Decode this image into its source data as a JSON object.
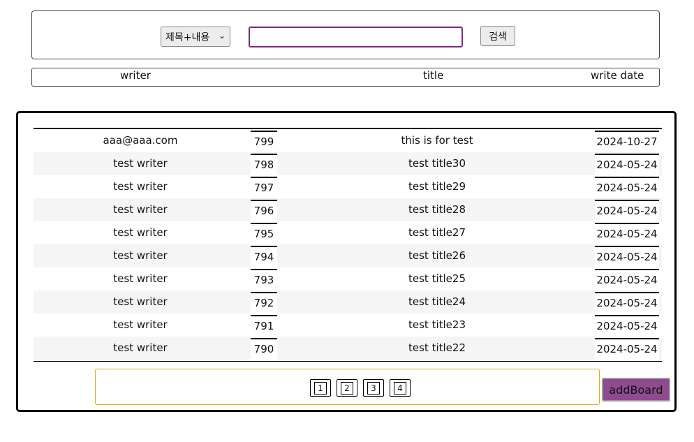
{
  "search": {
    "select_value": "제목+내용",
    "input_value": "",
    "button_label": "검색"
  },
  "header": {
    "writer": "writer",
    "title": "title",
    "write_date": "write date"
  },
  "rows": [
    {
      "writer": "aaa@aaa.com",
      "num": "799",
      "title": "this is for test",
      "date": "2024-10-27"
    },
    {
      "writer": "test writer",
      "num": "798",
      "title": "test title30",
      "date": "2024-05-24"
    },
    {
      "writer": "test writer",
      "num": "797",
      "title": "test title29",
      "date": "2024-05-24"
    },
    {
      "writer": "test writer",
      "num": "796",
      "title": "test title28",
      "date": "2024-05-24"
    },
    {
      "writer": "test writer",
      "num": "795",
      "title": "test title27",
      "date": "2024-05-24"
    },
    {
      "writer": "test writer",
      "num": "794",
      "title": "test title26",
      "date": "2024-05-24"
    },
    {
      "writer": "test writer",
      "num": "793",
      "title": "test title25",
      "date": "2024-05-24"
    },
    {
      "writer": "test writer",
      "num": "792",
      "title": "test title24",
      "date": "2024-05-24"
    },
    {
      "writer": "test writer",
      "num": "791",
      "title": "test title23",
      "date": "2024-05-24"
    },
    {
      "writer": "test writer",
      "num": "790",
      "title": "test title22",
      "date": "2024-05-24"
    }
  ],
  "pagination": {
    "pages": [
      "1",
      "2",
      "3",
      "4"
    ]
  },
  "add_board_label": "addBoard",
  "colors": {
    "search_input_border": "#7b2a7e",
    "pagination_border": "#e0a81e",
    "add_board_bg": "#8e4b8f"
  }
}
